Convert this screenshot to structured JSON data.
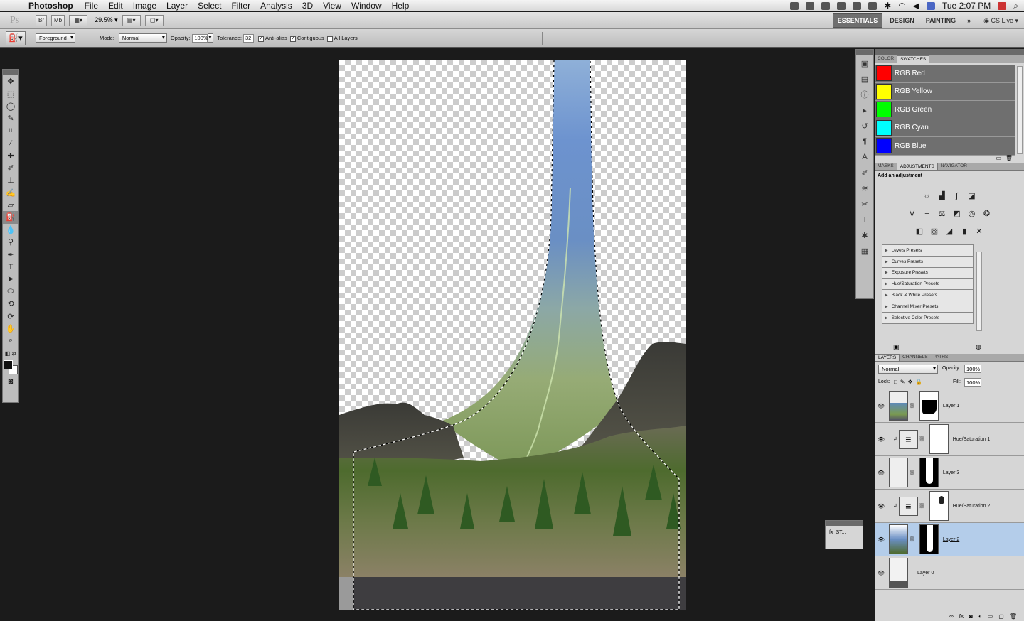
{
  "menubar": {
    "app_name": "Photoshop",
    "menus": [
      "File",
      "Edit",
      "Image",
      "Layer",
      "Select",
      "Filter",
      "Analysis",
      "3D",
      "View",
      "Window",
      "Help"
    ],
    "clock": "Tue 2:07 PM"
  },
  "appbar": {
    "logo": "Ps",
    "bridge_label": "Br",
    "mini_bridge_label": "Mb",
    "zoom": "29.5%",
    "workspaces": [
      "ESSENTIALS",
      "DESIGN",
      "PAINTING"
    ],
    "active_workspace": "ESSENTIALS",
    "more": "»",
    "cs_live": "CS Live"
  },
  "options": {
    "fill_source": "Foreground",
    "mode_label": "Mode:",
    "mode_value": "Normal",
    "opacity_label": "Opacity:",
    "opacity_value": "100%",
    "tolerance_label": "Tolerance:",
    "tolerance_value": "32",
    "anti_alias": "Anti-alias",
    "contiguous": "Contiguous",
    "all_layers": "All Layers"
  },
  "tools": [
    "move",
    "marquee",
    "lasso",
    "quick-select",
    "crop",
    "eyedropper",
    "healing",
    "brush",
    "stamp",
    "history-brush",
    "eraser",
    "paint-bucket",
    "blur",
    "dodge",
    "pen",
    "type",
    "path-select",
    "shape",
    "3d-rotate",
    "3d-camera",
    "hand",
    "zoom"
  ],
  "swatches_panel": {
    "tabs": [
      "COLOR",
      "SWATCHES"
    ],
    "active_tab": "SWATCHES",
    "items": [
      {
        "name": "RGB Red",
        "color": "#ff0000"
      },
      {
        "name": "RGB Yellow",
        "color": "#ffff00"
      },
      {
        "name": "RGB Green",
        "color": "#00ff00"
      },
      {
        "name": "RGB Cyan",
        "color": "#00ffff"
      },
      {
        "name": "RGB Blue",
        "color": "#0000ff"
      }
    ]
  },
  "adjustments_panel": {
    "tabs": [
      "MASKS",
      "ADJUSTMENTS",
      "NAVIGATOR"
    ],
    "active_tab": "ADJUSTMENTS",
    "heading": "Add an adjustment",
    "presets": [
      "Levels Presets",
      "Curves Presets",
      "Exposure Presets",
      "Hue/Saturation Presets",
      "Black & White Presets",
      "Channel Mixer Presets",
      "Selective Color Presets"
    ]
  },
  "layers_panel": {
    "tabs": [
      "LAYERS",
      "CHANNELS",
      "PATHS"
    ],
    "active_tab": "LAYERS",
    "blend_mode": "Normal",
    "opacity_label": "Opacity:",
    "opacity_value": "100%",
    "lock_label": "Lock:",
    "fill_label": "Fill:",
    "fill_value": "100%",
    "layers": [
      {
        "name": "Layer 1",
        "kind": "image",
        "active": false
      },
      {
        "name": "Hue/Saturation 1",
        "kind": "adjustment",
        "active": false
      },
      {
        "name": "Layer 3",
        "kind": "image",
        "active": false
      },
      {
        "name": "Hue/Saturation 2",
        "kind": "adjustment",
        "active": false
      },
      {
        "name": "Layer 2",
        "kind": "image",
        "active": true
      },
      {
        "name": "Layer 0",
        "kind": "image",
        "active": false
      }
    ]
  },
  "mini_panel": {
    "label": "ST..."
  },
  "colors": {
    "accent": "#b4cdea",
    "workspace_active": "#6f6f6f"
  }
}
